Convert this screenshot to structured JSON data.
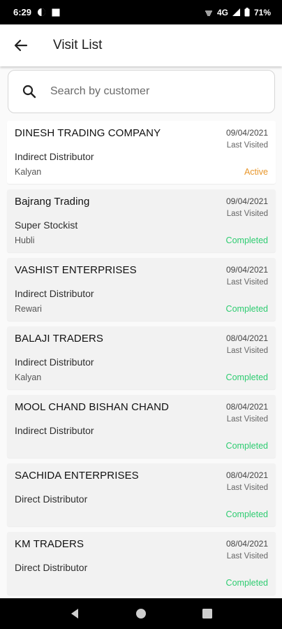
{
  "status_bar": {
    "time": "6:29",
    "network": "4G",
    "battery": "71%"
  },
  "app_bar": {
    "title": "Visit List"
  },
  "search": {
    "placeholder": "Search by customer",
    "value": ""
  },
  "visits": [
    {
      "name": "DINESH TRADING COMPANY",
      "type": "Indirect Distributor",
      "city": "Kalyan",
      "date": "09/04/2021",
      "last_visited_label": "Last Visited",
      "status": "Active"
    },
    {
      "name": "Bajrang Trading",
      "type": "Super Stockist",
      "city": "Hubli",
      "date": "09/04/2021",
      "last_visited_label": "Last Visited",
      "status": "Completed"
    },
    {
      "name": "VASHIST ENTERPRISES",
      "type": "Indirect Distributor",
      "city": "Rewari",
      "date": "09/04/2021",
      "last_visited_label": "Last Visited",
      "status": "Completed"
    },
    {
      "name": "BALAJI TRADERS",
      "type": "Indirect Distributor",
      "city": "Kalyan",
      "date": "08/04/2021",
      "last_visited_label": "Last Visited",
      "status": "Completed"
    },
    {
      "name": "MOOL CHAND BISHAN CHAND",
      "type": "Indirect Distributor",
      "city": "",
      "date": "08/04/2021",
      "last_visited_label": "Last Visited",
      "status": "Completed"
    },
    {
      "name": "SACHIDA ENTERPRISES",
      "type": "Direct Distributor",
      "city": "",
      "date": "08/04/2021",
      "last_visited_label": "Last Visited",
      "status": "Completed"
    },
    {
      "name": "KM TRADERS",
      "type": "Direct Distributor",
      "city": "",
      "date": "08/04/2021",
      "last_visited_label": "Last Visited",
      "status": "Completed"
    }
  ],
  "colors": {
    "active": "#e8962a",
    "completed": "#2ecc71"
  }
}
